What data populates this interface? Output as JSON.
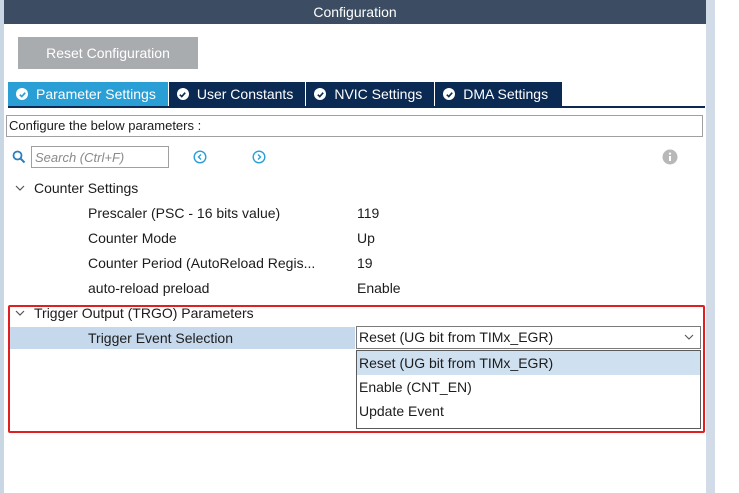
{
  "window": {
    "title": "Configuration"
  },
  "toolbar": {
    "reset_label": "Reset Configuration"
  },
  "tabs": [
    {
      "label": "Parameter Settings",
      "active": true
    },
    {
      "label": "User Constants",
      "active": false
    },
    {
      "label": "NVIC Settings",
      "active": false
    },
    {
      "label": "DMA Settings",
      "active": false
    }
  ],
  "description": "Configure the below parameters :",
  "search": {
    "placeholder": "Search (Ctrl+F)",
    "value": ""
  },
  "icons": {
    "search": "search-icon",
    "prev": "circle-chevron-left-icon",
    "next": "circle-chevron-right-icon",
    "info": "info-icon",
    "expand": "chevron-down-icon",
    "check": "check-circle-icon"
  },
  "groups": {
    "counter": {
      "label": "Counter Settings",
      "params": [
        {
          "name": "Prescaler (PSC - 16 bits value)",
          "value": "119"
        },
        {
          "name": "Counter Mode",
          "value": "Up"
        },
        {
          "name": "Counter Period (AutoReload Regis...",
          "value": "19"
        },
        {
          "name": "auto-reload preload",
          "value": "Enable"
        }
      ]
    },
    "trgo": {
      "label": "Trigger Output (TRGO) Parameters",
      "param": {
        "name": "Trigger Event Selection",
        "value": "Reset (UG bit from TIMx_EGR)"
      },
      "options": [
        "Reset (UG bit from TIMx_EGR)",
        "Enable (CNT_EN)",
        "Update Event"
      ]
    }
  },
  "colors": {
    "titlebar": "#3c4d63",
    "tab_active": "#2a9fd6",
    "tab_inactive": "#0b2a53",
    "highlight": "#e02020",
    "selected_row": "#c5d8ec"
  }
}
